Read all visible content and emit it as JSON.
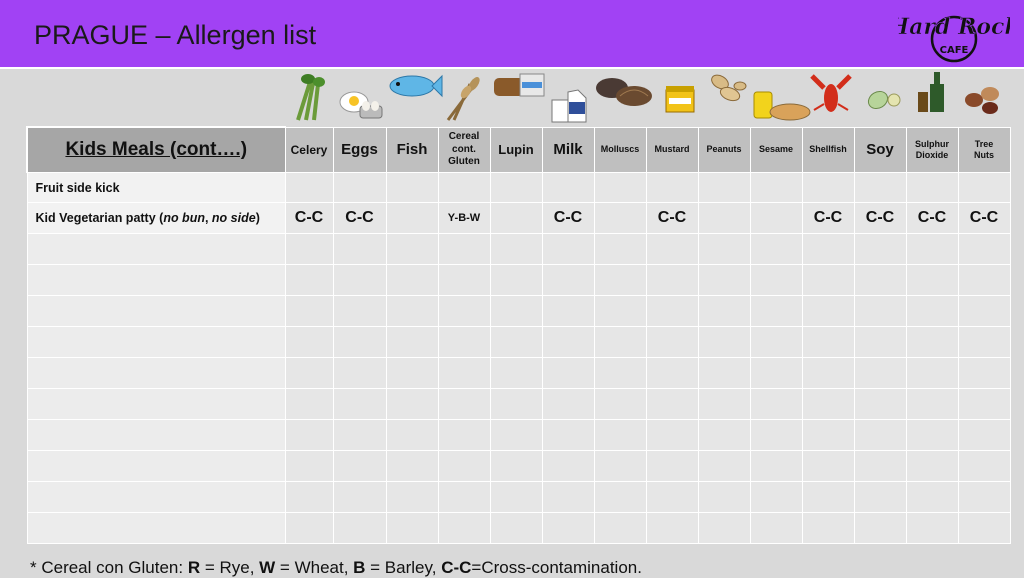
{
  "header": {
    "title": "PRAGUE – Allergen list",
    "logo_text_1": "Hard Rock",
    "logo_text_2": "CAFE",
    "color": "#a142f4"
  },
  "table": {
    "menu_heading": "Kids Meals (cont….)",
    "columns": [
      {
        "label": "Celery",
        "icon": "celery-icon"
      },
      {
        "label": "Eggs",
        "icon": "eggs-icon"
      },
      {
        "label": "Fish",
        "icon": "fish-icon"
      },
      {
        "label": "Cereal cont. Gluten",
        "icon": "wheat-icon"
      },
      {
        "label": "Lupin",
        "icon": "bread-icon"
      },
      {
        "label": "Milk",
        "icon": "milk-icon"
      },
      {
        "label": "Molluscs",
        "icon": "mollusc-shell-icon"
      },
      {
        "label": "Mustard",
        "icon": "mustard-jar-icon"
      },
      {
        "label": "Peanuts",
        "icon": "peanuts-icon"
      },
      {
        "label": "Sesame",
        "icon": "sesame-bun-icon"
      },
      {
        "label": "Shellfish",
        "icon": "lobster-icon"
      },
      {
        "label": "Soy",
        "icon": "soybean-icon"
      },
      {
        "label": "Sulphur Dioxide",
        "icon": "wine-bottle-icon"
      },
      {
        "label": "Tree Nuts",
        "icon": "tree-nuts-icon"
      }
    ],
    "rows": [
      {
        "name": "Fruit side kick",
        "name_parts": null,
        "cells": [
          "",
          "",
          "",
          "",
          "",
          "",
          "",
          "",
          "",
          "",
          "",
          "",
          "",
          ""
        ]
      },
      {
        "name": "",
        "name_parts": {
          "pre": "Kid Vegetarian patty (",
          "i1": "no bun",
          "mid": ", ",
          "i2": "no side",
          "post": ")"
        },
        "cells": [
          "C-C",
          "C-C",
          "",
          "Y-B-W",
          "",
          "C-C",
          "",
          "C-C",
          "",
          "",
          "C-C",
          "C-C",
          "C-C",
          "C-C"
        ]
      }
    ],
    "blank_row_count": 10
  },
  "footnote": {
    "prefix": "* Cereal con Gluten: ",
    "r": "R",
    "r_text": " = Rye, ",
    "w": "W",
    "w_text": " = Wheat, ",
    "b": "B",
    "b_text": " = Barley, ",
    "cc": "C-C",
    "cc_text": "=Cross-contamination."
  }
}
